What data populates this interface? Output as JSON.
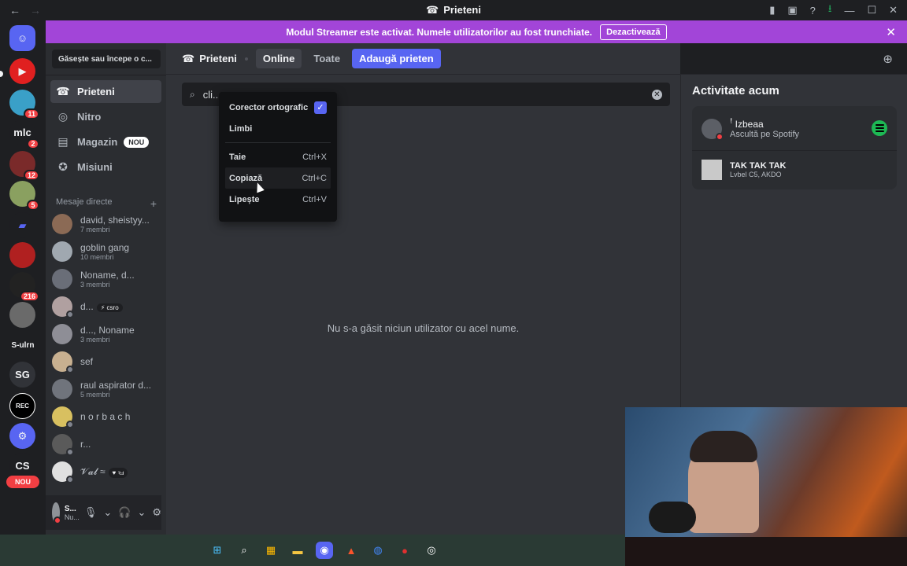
{
  "window": {
    "title": "Prieteni",
    "back": "←",
    "forward": "→",
    "icons": [
      "bookmark-icon",
      "inbox-icon",
      "help-icon",
      "download-icon"
    ],
    "controls": [
      "—",
      "☐",
      "✕"
    ]
  },
  "banner": {
    "text": "Modul Streamer este activat. Numele utilizatorilor au fost trunchiate.",
    "button": "Dezactivează",
    "close": "✕",
    "color": "#a245d8"
  },
  "guilds": [
    {
      "badge": ""
    },
    {
      "badge": "11"
    },
    {
      "label": "mlc",
      "badge": "2"
    },
    {
      "badge": "12"
    },
    {
      "badge": "5"
    },
    {
      "badge": ""
    },
    {
      "badge": ""
    },
    {
      "badge": "216"
    },
    {
      "badge": ""
    },
    {
      "label": "S-ulrn"
    },
    {
      "label": "SG"
    },
    {
      "label": "REC"
    },
    {
      "badge": ""
    },
    {
      "label": "CS"
    }
  ],
  "guild_nou": "NOU",
  "sidebar": {
    "search_placeholder": "Găsește sau începe o c...",
    "items": [
      {
        "label": "Prieteni",
        "icon": "friends-icon",
        "glyph": "☎"
      },
      {
        "label": "Nitro",
        "icon": "nitro-icon",
        "glyph": "◎"
      },
      {
        "label": "Magazin",
        "icon": "shop-icon",
        "glyph": "▤",
        "badge": "NOU"
      },
      {
        "label": "Misiuni",
        "icon": "quests-icon",
        "glyph": "✪"
      }
    ],
    "dm_header": "Mesaje directe",
    "dm_add": "+",
    "dms": [
      {
        "name": "david, sheistyy...",
        "sub": "7 membri"
      },
      {
        "name": "goblin gang",
        "sub": "10 membri"
      },
      {
        "name": "Noname, d...",
        "sub": "3 membri"
      },
      {
        "name": "d...",
        "sub": "",
        "tag": "⚡ csro"
      },
      {
        "name": "d..., Noname",
        "sub": "3 membri"
      },
      {
        "name": "sef",
        "sub": ""
      },
      {
        "name": "raul aspirator d...",
        "sub": "5 membri"
      },
      {
        "name": "n o r b a c h",
        "sub": ""
      },
      {
        "name": "r...",
        "sub": ""
      },
      {
        "name": "𝓥𝓪𝓵 ≈",
        "sub": "",
        "tag": "♥ ꝛⅎ"
      }
    ]
  },
  "userbar": {
    "name": "S...",
    "status": "Nu...",
    "mic": "🎙",
    "headphones": "🎧",
    "settings": "⚙",
    "chevron": "⌄"
  },
  "topbar": {
    "title": "Prieteni",
    "tabs": [
      "Online",
      "Toate"
    ],
    "add_friend": "Adaugă prieten",
    "new_group": "⊕"
  },
  "search": {
    "value": "cli...",
    "clear": "✕"
  },
  "empty_text": "Nu s-a găsit niciun utilizator cu acel nume.",
  "context_menu": {
    "items": [
      {
        "label": "Corector ortografic",
        "checked": true
      },
      {
        "label": "Limbi"
      },
      {
        "label": "Taie",
        "shortcut": "Ctrl+X"
      },
      {
        "label": "Copiază",
        "shortcut": "Ctrl+C"
      },
      {
        "label": "Lipește",
        "shortcut": "Ctrl+V"
      }
    ]
  },
  "activity": {
    "title": "Activitate acum",
    "user": "ꜝ Izbeaa",
    "subtitle": "Ascultă pe Spotify",
    "song": "TAK TAK TAK",
    "artist": "Lvbel C5, AKDO"
  },
  "taskbar": [
    "⊞",
    "⌕",
    "▦",
    "▬",
    "◉",
    "▲",
    "◍",
    "●",
    "◎"
  ]
}
